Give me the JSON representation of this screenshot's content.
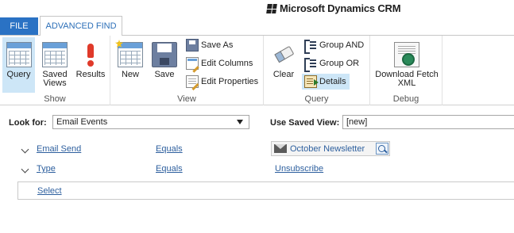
{
  "brand": {
    "text": "Microsoft Dynamics CRM"
  },
  "tabs": {
    "file": "FILE",
    "advanced_find": "ADVANCED FIND"
  },
  "ribbon": {
    "show": {
      "label": "Show",
      "query": "Query",
      "saved_views_line1": "Saved",
      "saved_views_line2": "Views",
      "results": "Results"
    },
    "view": {
      "label": "View",
      "new": "New",
      "save": "Save",
      "save_as": "Save As",
      "edit_columns": "Edit Columns",
      "edit_properties": "Edit Properties"
    },
    "query": {
      "label": "Query",
      "clear": "Clear",
      "group_and": "Group AND",
      "group_or": "Group OR",
      "details": "Details"
    },
    "debug": {
      "label": "Debug",
      "download_line1": "Download Fetch",
      "download_line2": "XML"
    }
  },
  "lookfor": {
    "label": "Look for:",
    "value": "Email Events"
  },
  "saved_view": {
    "label": "Use Saved View:",
    "value": "[new]"
  },
  "criteria": [
    {
      "field": "Email Send",
      "operator": "Equals",
      "value": "October Newsletter"
    },
    {
      "field": "Type",
      "operator": "Equals",
      "value": "Unsubscribe"
    }
  ],
  "select_link": "Select",
  "colors": {
    "accent": "#2a72c4",
    "link": "#2d5f9e",
    "selected": "#cde6f7"
  }
}
